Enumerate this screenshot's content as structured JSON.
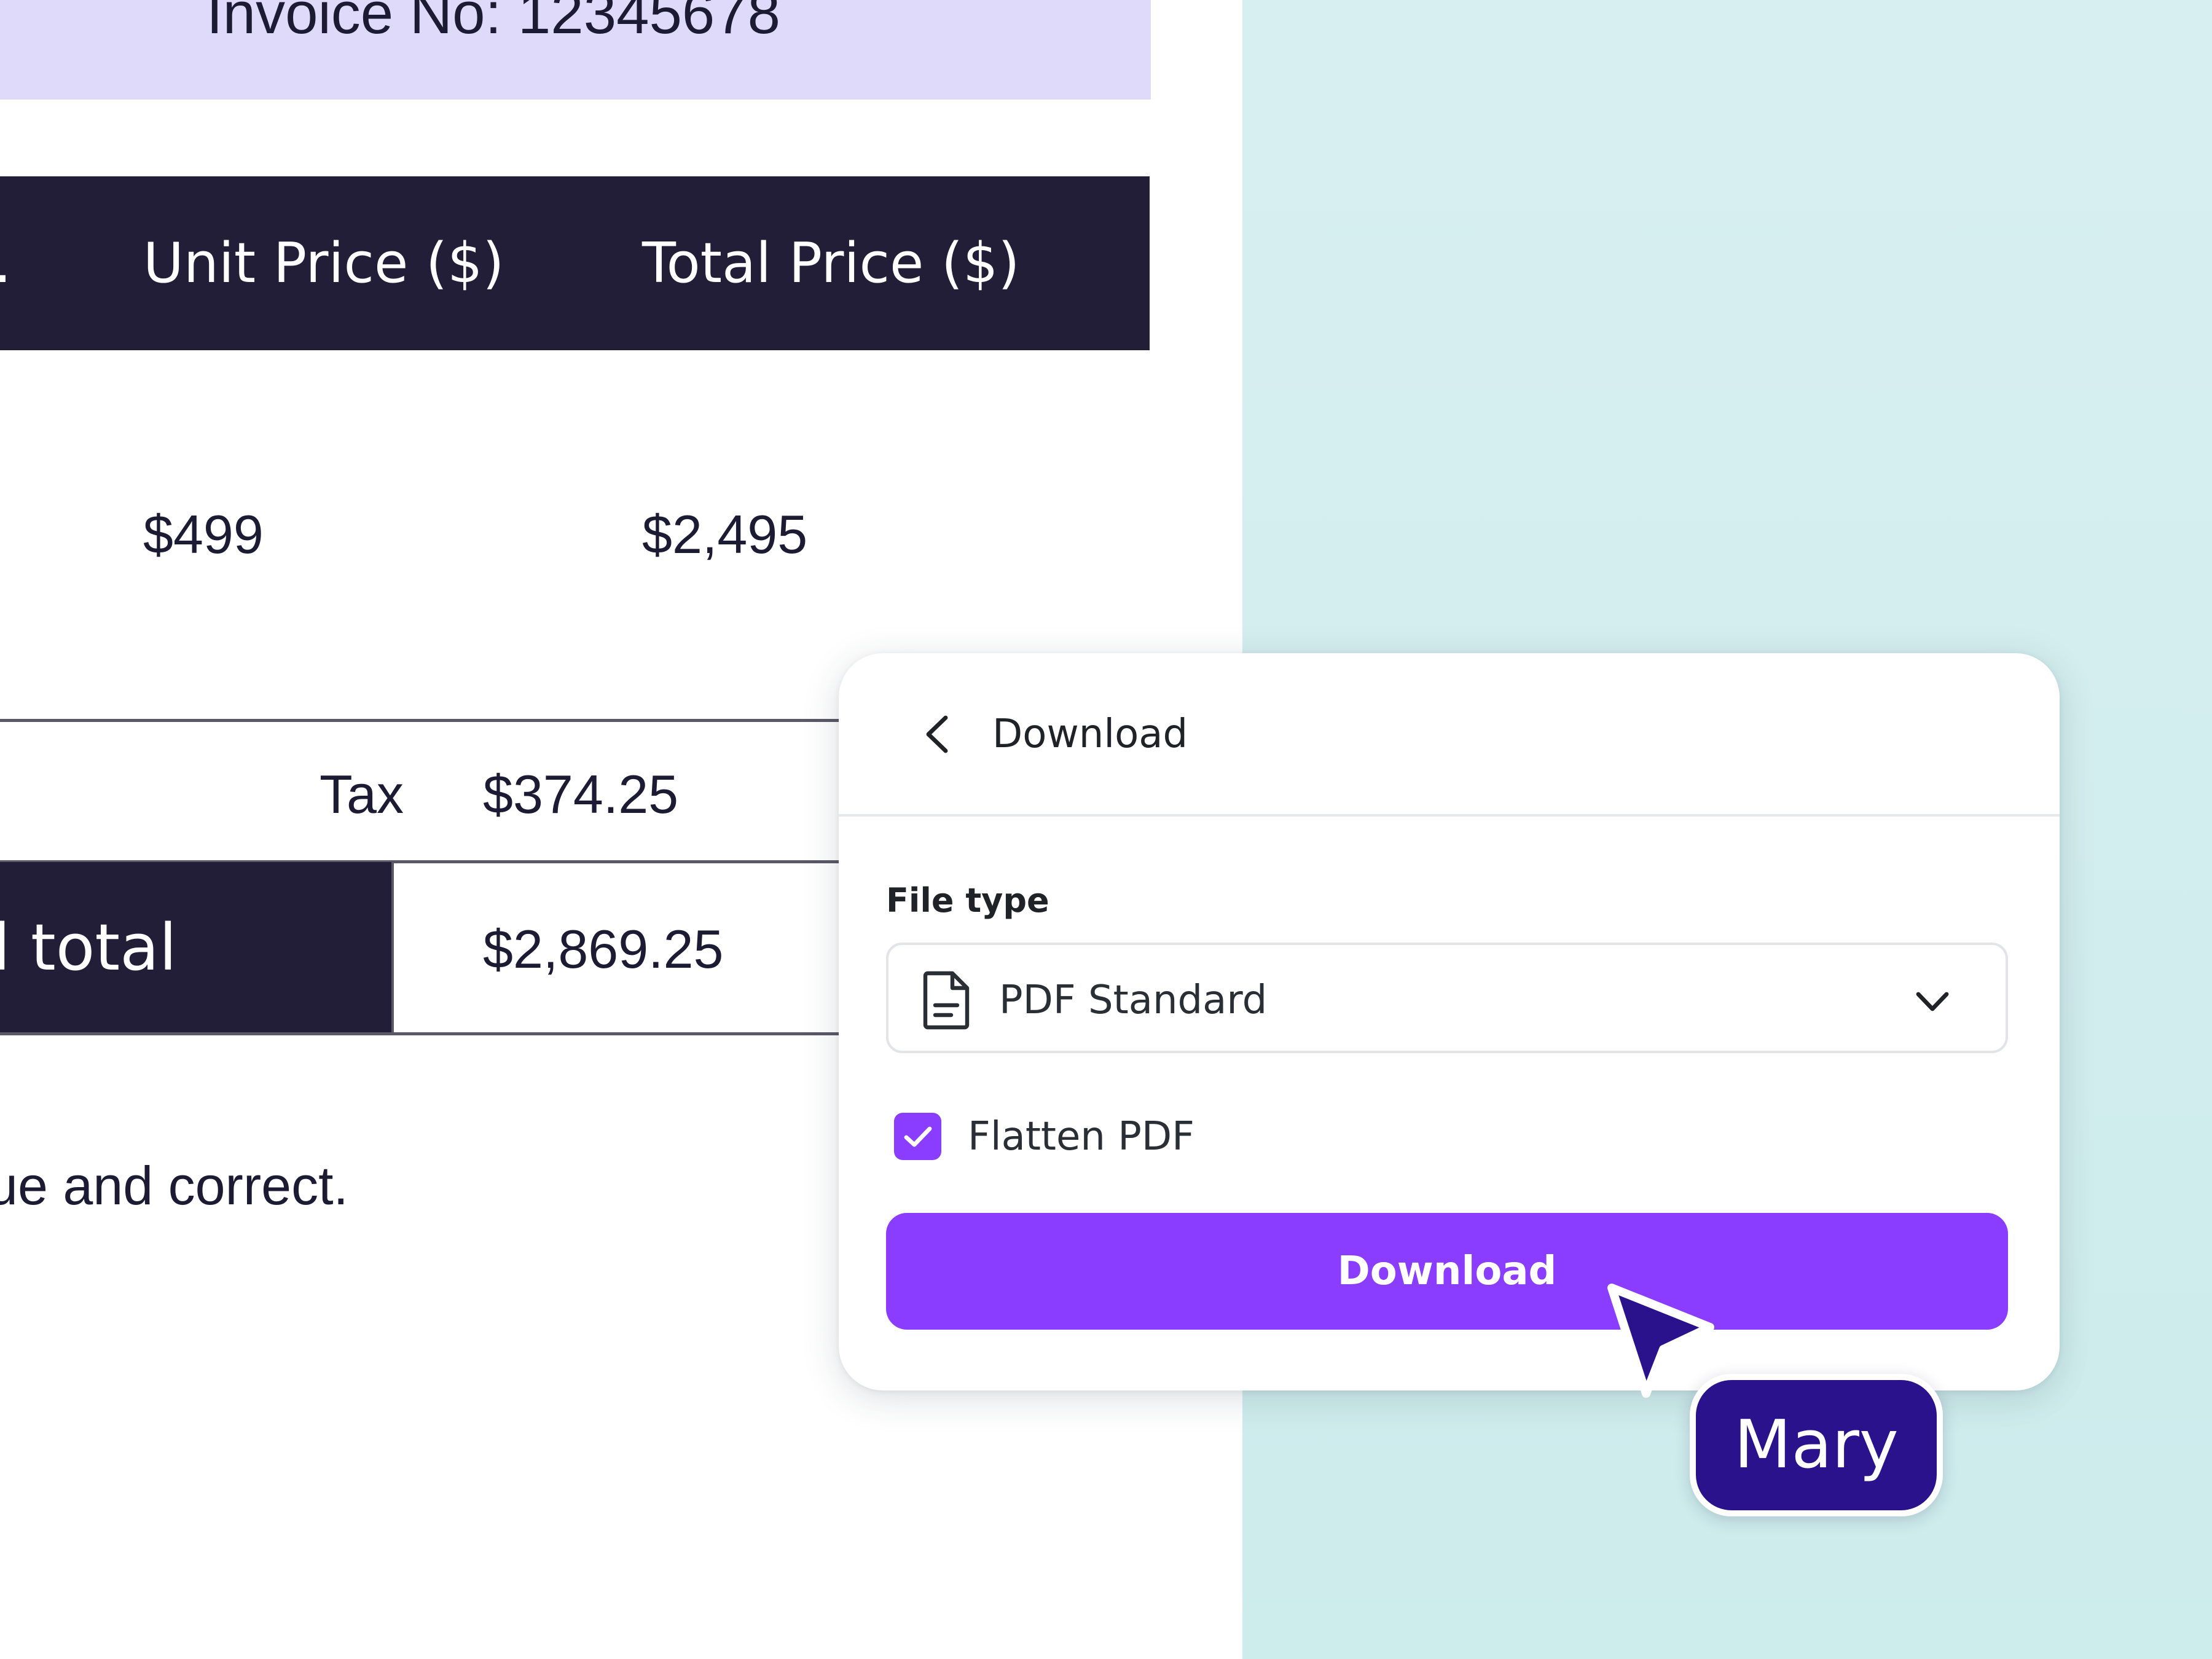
{
  "invoice": {
    "number_label": "Invoice No: 12345678",
    "table_header": {
      "cut_column": ".",
      "unit_price": "Unit Price ($)",
      "total_price": "Total Price ($)"
    },
    "rows": [
      {
        "unit_price": "$499",
        "total_price": "$2,495"
      }
    ],
    "tax_label": "Tax",
    "tax_value": "$374.25",
    "grand_total_label": "l total",
    "grand_total_value": "$2,869.25",
    "declaration": "ue and correct."
  },
  "download_panel": {
    "title": "Download",
    "back_icon": "chevron-left-icon",
    "file_type_label": "File type",
    "file_type_value": "PDF Standard",
    "file_icon": "file-document-icon",
    "dropdown_icon": "chevron-down-icon",
    "flatten_label": "Flatten PDF",
    "flatten_checked": true,
    "download_button_label": "Download"
  },
  "collaborator": {
    "name": "Mary"
  },
  "colors": {
    "accent": "#8b3dff",
    "invoice_dark": "#221e38",
    "invoice_band": "#e0dafa",
    "teal_background": "#d3eeef",
    "cursor_tag": "#2b128d"
  }
}
